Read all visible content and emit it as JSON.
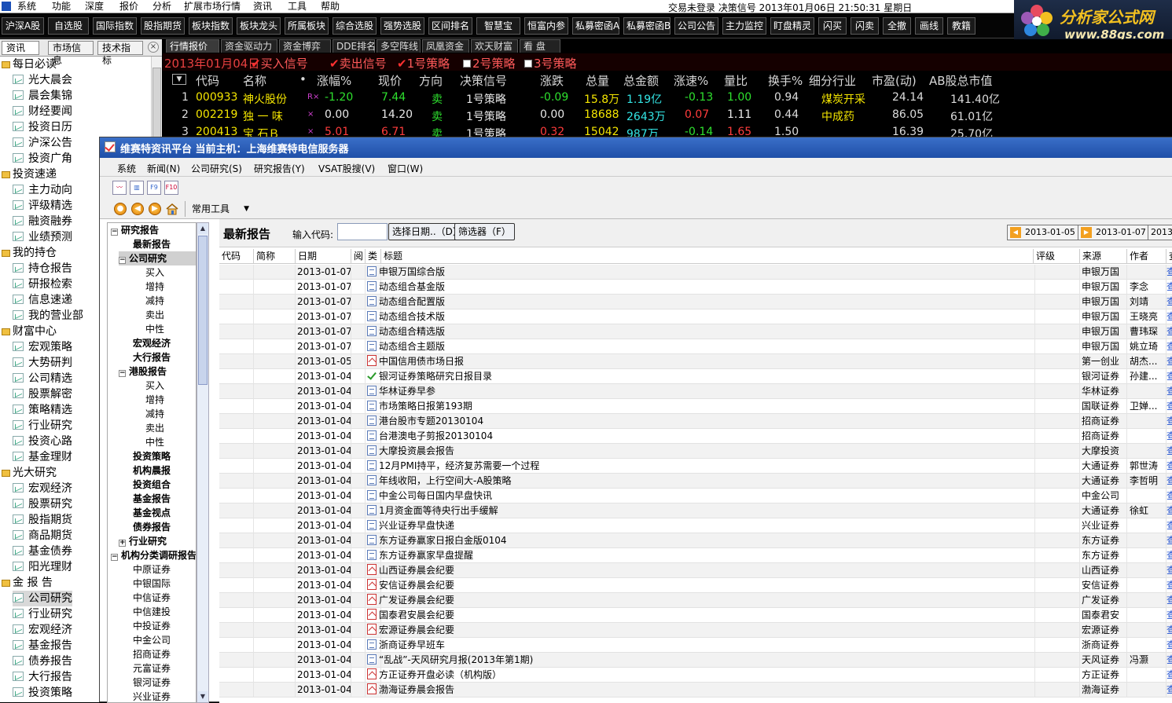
{
  "menubar": {
    "items": [
      "系统",
      "功能",
      "深度",
      "报价",
      "分析",
      "扩展市场行情",
      "资讯",
      "工具",
      "帮助"
    ],
    "status": "交易未登录  决策信号  2013年01月06日  21:50:31  星期日"
  },
  "brand": {
    "title": "分析家公式网",
    "url": "www.88gs.com"
  },
  "toolbar": [
    "沪深A股",
    "自选股",
    "国际指数",
    "股指期货",
    "板块指数",
    "板块龙头",
    "所属板块",
    "综合选股",
    "强势选股",
    "区间排名",
    "智慧宝",
    "恒富内参",
    "私募密函A",
    "私募密函B",
    "公司公告",
    "主力监控",
    "盯盘精灵",
    "闪买",
    "闪卖",
    "全撤",
    "画线",
    "教籍"
  ],
  "left_tabs": [
    "资讯",
    "市场信息",
    "技术指标"
  ],
  "left_tree": {
    "groups": [
      {
        "label": "每日必读",
        "items": [
          "光大晨会",
          "晨会集锦",
          "财经要闻",
          "投资日历",
          "沪深公告",
          "投资广角"
        ]
      },
      {
        "label": "投资速递",
        "items": [
          "主力动向",
          "评级精选",
          "融资融券",
          "业绩预测"
        ]
      },
      {
        "label": "我的持仓",
        "items": [
          "持仓报告",
          "研报检索",
          "信息速递",
          "我的营业部"
        ]
      },
      {
        "label": "财富中心",
        "items": [
          "宏观策略",
          "大势研判",
          "公司精选",
          "股票解密",
          "策略精选",
          "行业研究",
          "投资心路",
          "基金理财"
        ]
      },
      {
        "label": "光大研究",
        "items": [
          "宏观经济",
          "股票研究",
          "股指期货",
          "商品期货",
          "基金债券",
          "阳光理财"
        ]
      },
      {
        "label": "金 报 告",
        "items": [
          "公司研究",
          "行业研究",
          "宏观经济",
          "基金报告",
          "债券报告",
          "大行报告",
          "投资策略"
        ]
      }
    ],
    "selected": "公司研究"
  },
  "stock_tabs": [
    "行情报价",
    "资金驱动力",
    "资金博弈",
    "DDE排名",
    "多空阵线",
    "凤凰资金",
    "欢天财富",
    "看  盘"
  ],
  "signal_bar": {
    "date": "2013年01月04日",
    "signals": [
      {
        "label": "买入信号",
        "checked": true
      },
      {
        "label": "卖出信号",
        "checked": true
      },
      {
        "label": "1号策略",
        "checked": true
      },
      {
        "label": "2号策略",
        "checked": false
      },
      {
        "label": "3号策略",
        "checked": false
      }
    ]
  },
  "stock_table": {
    "headers": [
      "代码",
      "名称",
      "•",
      "涨幅%",
      "现价",
      "方向",
      "决策信号",
      "涨跌",
      "总量",
      "总金额",
      "涨速%",
      "量比",
      "换手%",
      "细分行业",
      "市盈(动)",
      "AB股总市值"
    ],
    "rows": [
      {
        "n": "1",
        "code": "000933",
        "name": "神火股份",
        "flag": "R×",
        "chg": "-1.20",
        "price": "7.44",
        "dir": "卖",
        "signal": "1号策略",
        "diff": "-0.09",
        "vol": "15.8万",
        "amt": "1.19亿",
        "speed": "-0.13",
        "ratio": "1.00",
        "turn": "0.94",
        "ind": "煤炭开采",
        "pe": "24.14",
        "cap": "141.40亿"
      },
      {
        "n": "2",
        "code": "002219",
        "name": "独 一 味",
        "flag": "×",
        "chg": "0.00",
        "price": "14.20",
        "dir": "卖",
        "signal": "1号策略",
        "diff": "0.00",
        "vol": "18688",
        "amt": "2643万",
        "speed": "0.07",
        "ratio": "1.11",
        "turn": "0.44",
        "ind": "中成药",
        "pe": "86.05",
        "cap": "61.01亿"
      },
      {
        "n": "3",
        "code": "200413",
        "name": "宝 石Ｂ",
        "flag": "×",
        "chg": "5.01",
        "price": "6.71",
        "dir": "卖",
        "signal": "1号策略",
        "diff": "0.32",
        "vol": "15042",
        "amt": "987万",
        "speed": "-0.14",
        "ratio": "1.65",
        "turn": "1.50",
        "ind": "",
        "pe": "16.39",
        "cap": "25.70亿"
      }
    ]
  },
  "research": {
    "window_title": "维赛特资讯平台   当前主机：上海维赛特电信服务器",
    "menu": [
      "系统",
      "新闻(N)",
      "公司研究(S)",
      "研究报告(Y)",
      "VSAT股搜(V)",
      "窗口(W)"
    ],
    "common_tools": "常用工具",
    "tree": [
      {
        "label": "研究报告",
        "level": 0,
        "bold": true,
        "pm": "-"
      },
      {
        "label": "最新报告",
        "level": 1,
        "bold": true
      },
      {
        "label": "公司研究",
        "level": 1,
        "bold": true,
        "pm": "-",
        "sel": true
      },
      {
        "label": "买入",
        "level": 2
      },
      {
        "label": "增持",
        "level": 2
      },
      {
        "label": "减持",
        "level": 2
      },
      {
        "label": "卖出",
        "level": 2
      },
      {
        "label": "中性",
        "level": 2
      },
      {
        "label": "宏观经济",
        "level": 1,
        "bold": true
      },
      {
        "label": "大行报告",
        "level": 1,
        "bold": true
      },
      {
        "label": "港股报告",
        "level": 1,
        "bold": true,
        "pm": "-"
      },
      {
        "label": "买入",
        "level": 2
      },
      {
        "label": "增持",
        "level": 2
      },
      {
        "label": "减持",
        "level": 2
      },
      {
        "label": "卖出",
        "level": 2
      },
      {
        "label": "中性",
        "level": 2
      },
      {
        "label": "投资策略",
        "level": 1,
        "bold": true
      },
      {
        "label": "机构晨报",
        "level": 1,
        "bold": true
      },
      {
        "label": "投资组合",
        "level": 1,
        "bold": true
      },
      {
        "label": "基金报告",
        "level": 1,
        "bold": true
      },
      {
        "label": "基金视点",
        "level": 1,
        "bold": true
      },
      {
        "label": "债券报告",
        "level": 1,
        "bold": true
      },
      {
        "label": "行业研究",
        "level": 1,
        "bold": true,
        "pm": "+"
      },
      {
        "label": "机构分类调研报告",
        "level": 0,
        "bold": true,
        "pm": "-"
      },
      {
        "label": "中原证券",
        "level": 1
      },
      {
        "label": "中银国际",
        "level": 1
      },
      {
        "label": "中信证券",
        "level": 1
      },
      {
        "label": "中信建投",
        "level": 1
      },
      {
        "label": "中投证券",
        "level": 1
      },
      {
        "label": "中金公司",
        "level": 1
      },
      {
        "label": "招商证券",
        "level": 1
      },
      {
        "label": "元富证券",
        "level": 1
      },
      {
        "label": "银河证券",
        "level": 1
      },
      {
        "label": "兴业证券",
        "level": 1
      }
    ],
    "content_title": "最新报告",
    "code_label": "输入代码:",
    "date_button": "选择日期..（D）",
    "filter_button": "筛选器（F）",
    "date_prev": "2013-01-05",
    "date_next": "2013-01-07",
    "date_cut": "2013-",
    "columns": [
      "代码",
      "简称",
      "日期",
      "阅",
      "类",
      "标题",
      "评级",
      "来源",
      "作者",
      "查"
    ],
    "reports": [
      {
        "date": "2013-01-07",
        "icon": "doc",
        "title": "申银万国综合版",
        "src": "申银万国",
        "author": ""
      },
      {
        "date": "2013-01-07",
        "icon": "doc",
        "title": "动态组合基金版",
        "src": "申银万国",
        "author": "李念"
      },
      {
        "date": "2013-01-07",
        "icon": "doc",
        "title": "动态组合配置版",
        "src": "申银万国",
        "author": "刘靖"
      },
      {
        "date": "2013-01-07",
        "icon": "doc",
        "title": "动态组合技术版",
        "src": "申银万国",
        "author": "王晓亮"
      },
      {
        "date": "2013-01-07",
        "icon": "doc",
        "title": "动态组合精选版",
        "src": "申银万国",
        "author": "曹玮琛"
      },
      {
        "date": "2013-01-07",
        "icon": "doc",
        "title": "动态组合主题版",
        "src": "申银万国",
        "author": "姚立琦"
      },
      {
        "date": "2013-01-05",
        "icon": "pdf",
        "title": "中国信用债市场日报",
        "src": "第一创业",
        "author": "胡杰..."
      },
      {
        "date": "2013-01-04",
        "icon": "chk",
        "title": "银河证券策略研究日报目录",
        "src": "银河证券",
        "author": "孙建..."
      },
      {
        "date": "2013-01-04",
        "icon": "doc",
        "title": "华林证券早参",
        "src": "华林证券",
        "author": ""
      },
      {
        "date": "2013-01-04",
        "icon": "doc",
        "title": "市场策略日报第193期",
        "src": "国联证券",
        "author": "卫婵..."
      },
      {
        "date": "2013-01-04",
        "icon": "doc",
        "title": "港台股市专题20130104",
        "src": "招商证券",
        "author": ""
      },
      {
        "date": "2013-01-04",
        "icon": "doc",
        "title": "台港澳电子剪报20130104",
        "src": "招商证券",
        "author": ""
      },
      {
        "date": "2013-01-04",
        "icon": "doc",
        "title": "大摩投资晨会报告",
        "src": "大摩投资",
        "author": ""
      },
      {
        "date": "2013-01-04",
        "icon": "doc",
        "title": "12月PMI持平，经济复苏需要一个过程",
        "src": "大通证券",
        "author": "郭世涛"
      },
      {
        "date": "2013-01-04",
        "icon": "doc",
        "title": "年线收阳，上行空间大-A股策略",
        "src": "大通证券",
        "author": "李哲明"
      },
      {
        "date": "2013-01-04",
        "icon": "doc",
        "title": "中金公司每日国内早盘快讯",
        "src": "中金公司",
        "author": ""
      },
      {
        "date": "2013-01-04",
        "icon": "doc",
        "title": "1月资金面等待央行出手缓解",
        "src": "大通证券",
        "author": "徐虹"
      },
      {
        "date": "2013-01-04",
        "icon": "doc",
        "title": "兴业证券早盘快递",
        "src": "兴业证券",
        "author": ""
      },
      {
        "date": "2013-01-04",
        "icon": "doc",
        "title": "东方证券赢家日报白金版0104",
        "src": "东方证券",
        "author": ""
      },
      {
        "date": "2013-01-04",
        "icon": "doc",
        "title": "东方证券赢家早盘提醒",
        "src": "东方证券",
        "author": ""
      },
      {
        "date": "2013-01-04",
        "icon": "pdf",
        "title": "山西证券晨会纪要",
        "src": "山西证券",
        "author": ""
      },
      {
        "date": "2013-01-04",
        "icon": "pdf",
        "title": "安信证券晨会纪要",
        "src": "安信证券",
        "author": ""
      },
      {
        "date": "2013-01-04",
        "icon": "pdf",
        "title": "广发证券晨会纪要",
        "src": "广发证券",
        "author": ""
      },
      {
        "date": "2013-01-04",
        "icon": "pdf",
        "title": "国泰君安晨会纪要",
        "src": "国泰君安",
        "author": ""
      },
      {
        "date": "2013-01-04",
        "icon": "pdf",
        "title": "宏源证券晨会纪要",
        "src": "宏源证券",
        "author": ""
      },
      {
        "date": "2013-01-04",
        "icon": "doc",
        "title": "浙商证券早班车",
        "src": "浙商证券",
        "author": ""
      },
      {
        "date": "2013-01-04",
        "icon": "doc",
        "title": "“乱战”-天风研究月报(2013年第1期)",
        "src": "天风证券",
        "author": "冯灏"
      },
      {
        "date": "2013-01-04",
        "icon": "pdf",
        "title": "方正证券开盘必读（机构版）",
        "src": "方正证券",
        "author": ""
      },
      {
        "date": "2013-01-04",
        "icon": "pdf",
        "title": "渤海证券晨会报告",
        "src": "渤海证券",
        "author": ""
      }
    ]
  },
  "colors": {
    "up": "#ff3c3c",
    "down": "#2ee02e",
    "text_yellow": "#f5e600",
    "text_cyan": "#33e5e5",
    "link": "#1f4fd0"
  }
}
